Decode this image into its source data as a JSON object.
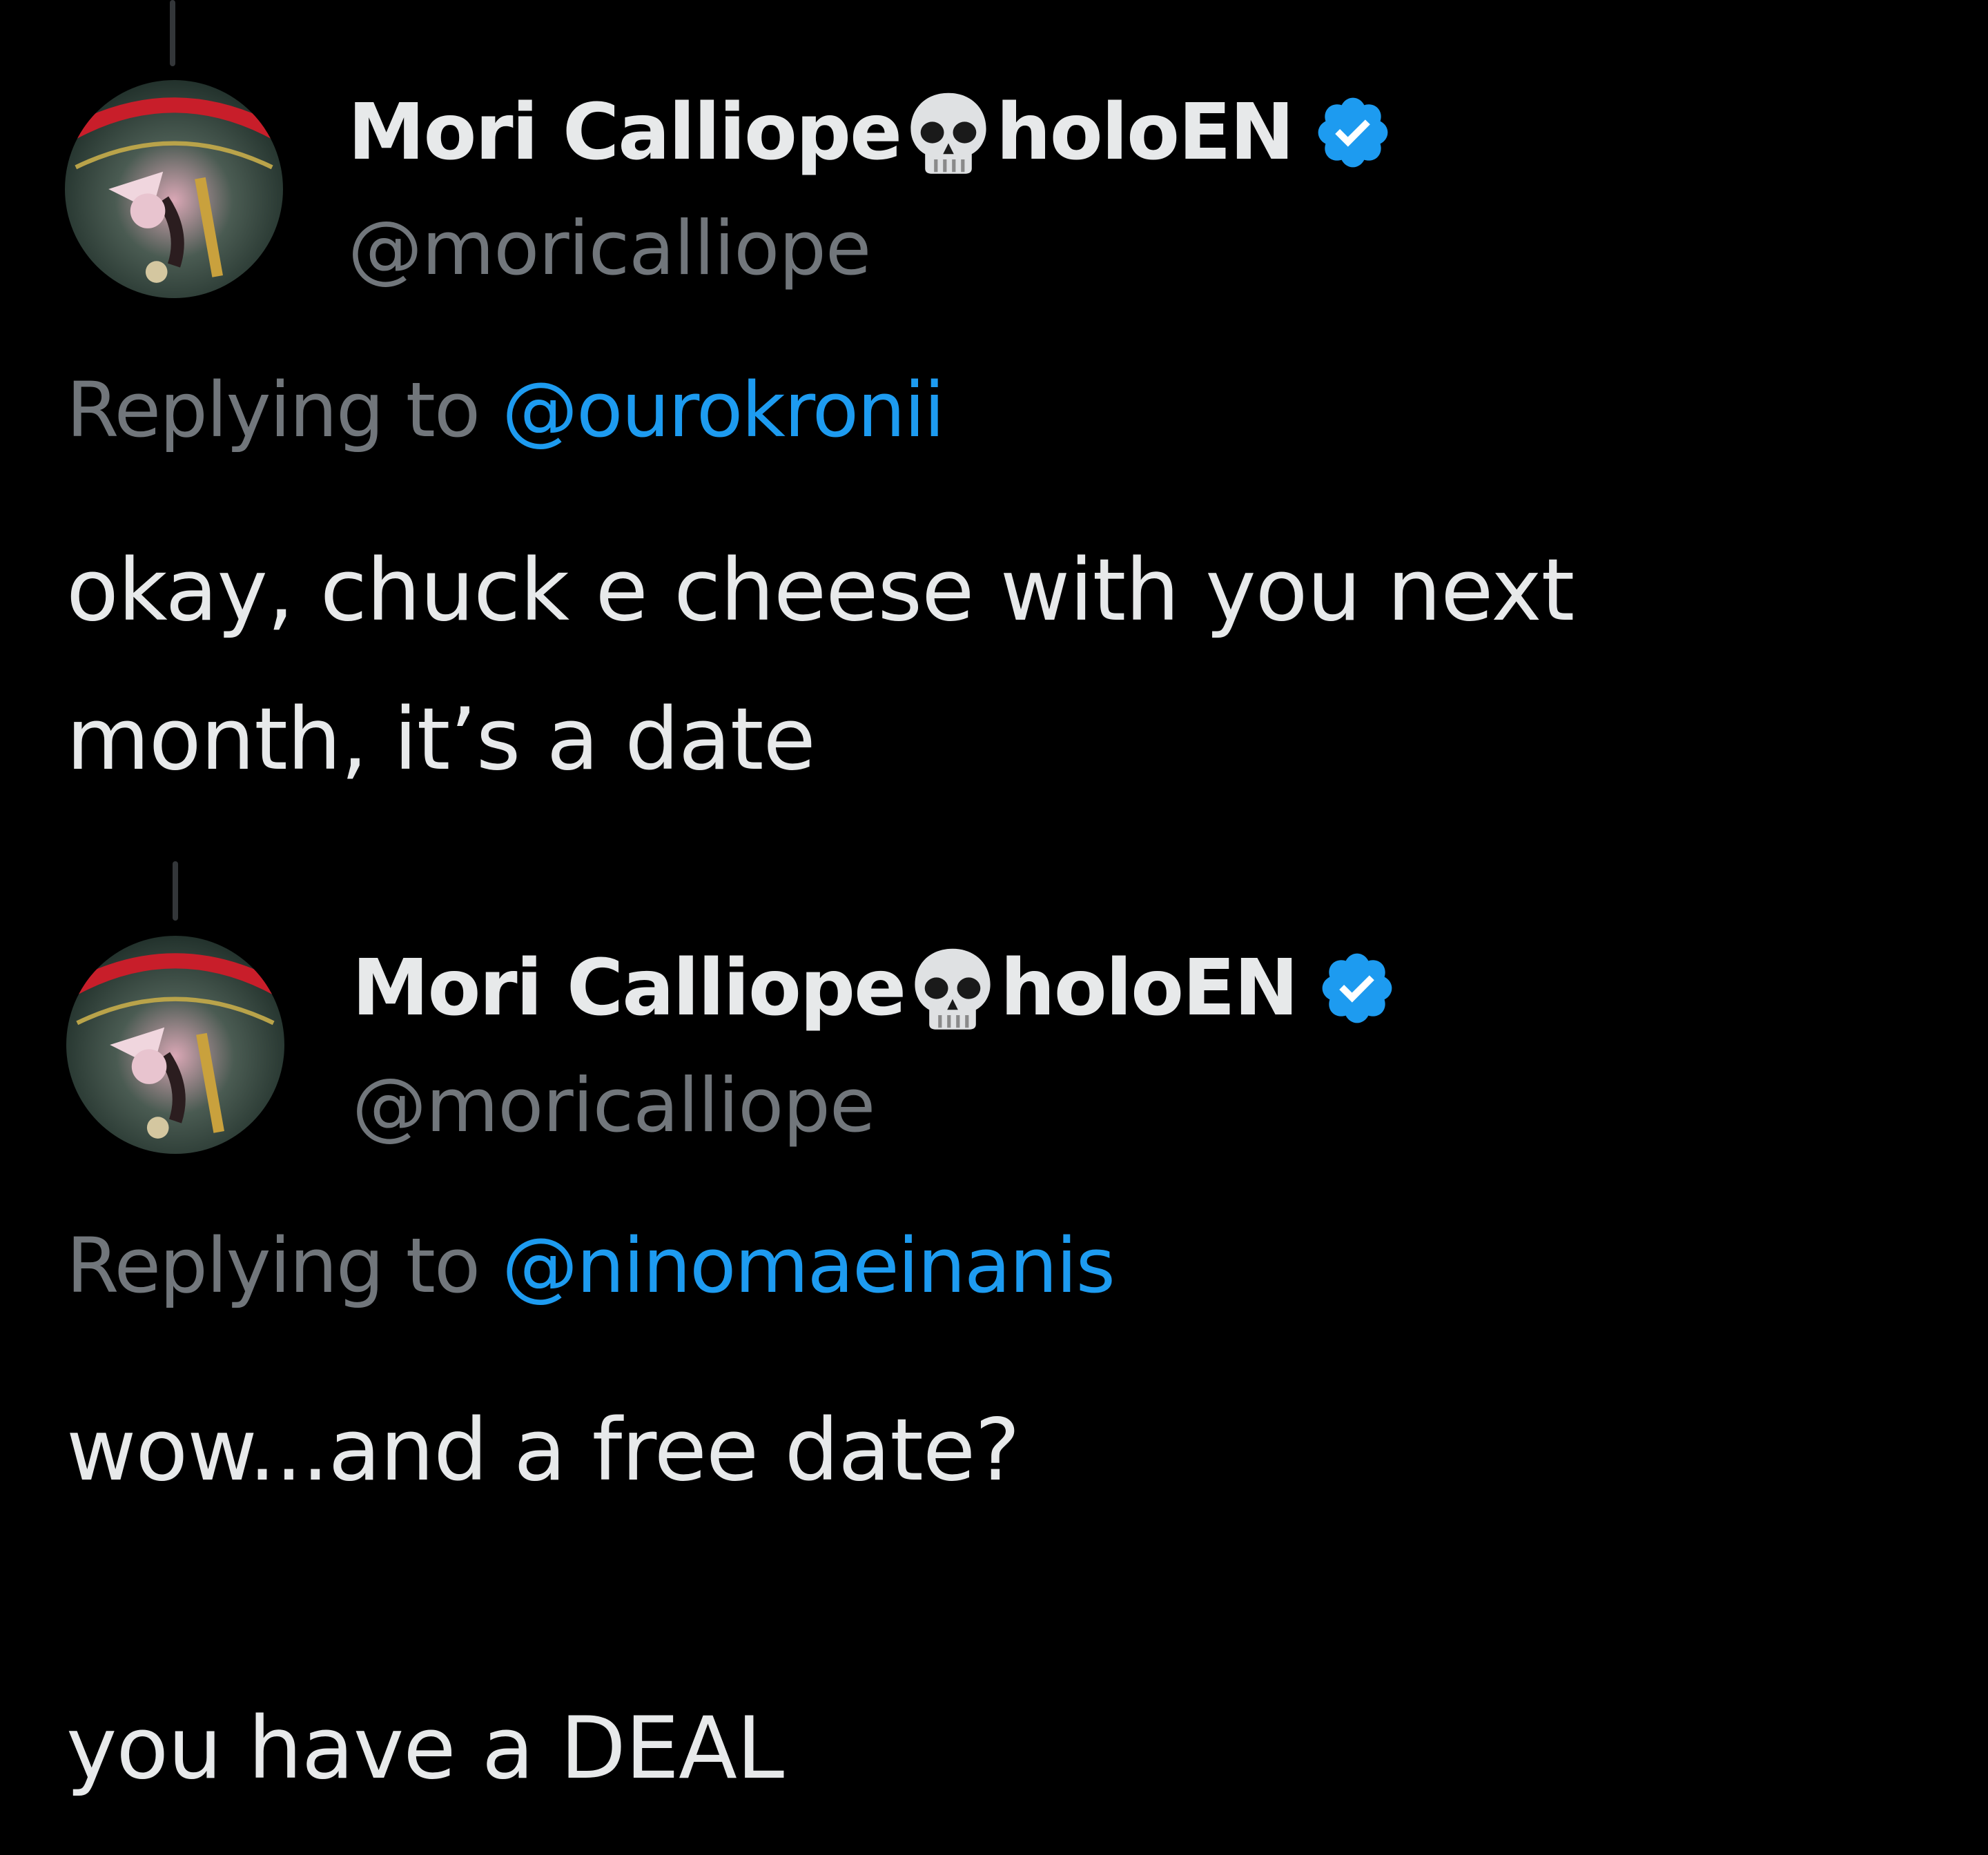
{
  "tweets": [
    {
      "author": {
        "name": "Mori Calliope",
        "name_emoji": "💀",
        "name_suffix": "holoEN",
        "handle": "@moricalliope",
        "verified": true
      },
      "replying_label": "Replying to",
      "replying_to": "@ourokronii",
      "text_lines": [
        "okay, chuck e cheese with you next",
        "month, it’s a date"
      ]
    },
    {
      "author": {
        "name": "Mori Calliope",
        "name_emoji": "💀",
        "name_suffix": "holoEN",
        "handle": "@moricalliope",
        "verified": true
      },
      "replying_label": "Replying to",
      "replying_to": "@ninomaeinanis",
      "text_lines": [
        "wow...and a free date?",
        "",
        "you have a DEAL"
      ]
    }
  ],
  "colors": {
    "background": "#000000",
    "text_primary": "#e7e9ea",
    "text_secondary": "#71767b",
    "accent": "#1d9bf0",
    "thread_line": "#333639"
  },
  "icons": [
    "avatar",
    "skull-icon",
    "verified-badge-icon"
  ]
}
